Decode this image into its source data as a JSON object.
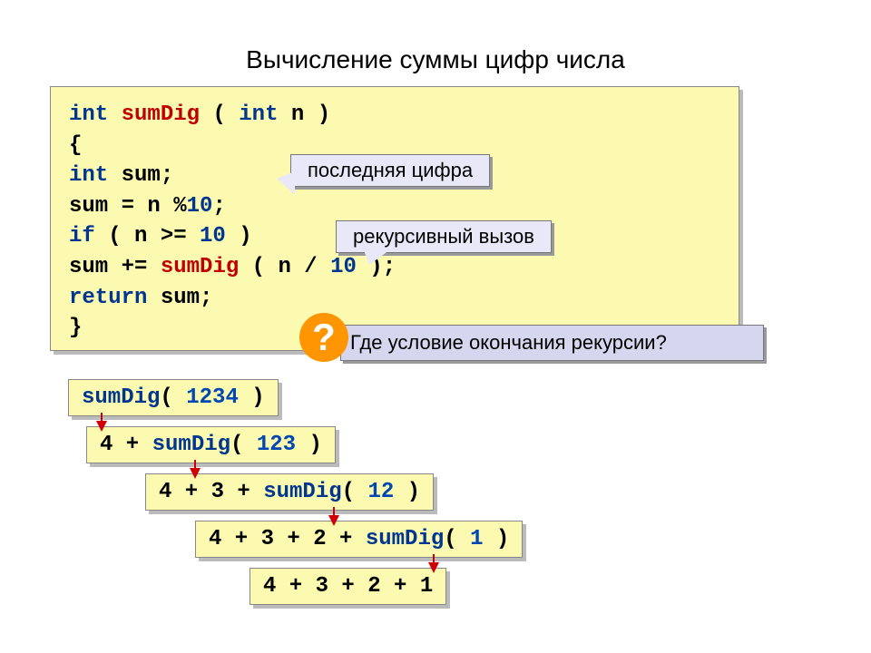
{
  "title": "Вычисление суммы цифр числа",
  "code": {
    "l1_int": "int",
    "l1_fn": "sumDig",
    "l1_rest1": " ( ",
    "l1_int2": "int",
    "l1_rest2": " n )",
    "l2": "{",
    "l3_indent": "   ",
    "l3_int": "int",
    "l3_rest": " sum;",
    "l4_indent": "   ",
    "l4_a": "sum = n %",
    "l4_num": "10",
    "l4_b": ";",
    "l5_indent": "   ",
    "l5_if": "if",
    "l5_a": " ( n >= ",
    "l5_num": "10",
    "l5_b": " )",
    "l6_indent": "    ",
    "l6_a": "sum += ",
    "l6_fn": "sumDig",
    "l6_b": " ( n / ",
    "l6_num": "10",
    "l6_c": " );",
    "l7_indent": "   ",
    "l7_ret": "return",
    "l7_rest": " sum;",
    "l8": "}"
  },
  "callout1": "последняя цифра",
  "callout2": "рекурсивный вызов",
  "question": "Где условие окончания рекурсии?",
  "qmark": "?",
  "trace": {
    "t0_fn": "sumDig",
    "t0_a": "( ",
    "t0_num": "1234",
    "t0_b": " )",
    "t1_a": "4 + ",
    "t1_fn": "sumDig",
    "t1_b": "( ",
    "t1_num": "123",
    "t1_c": " )",
    "t2_a": "4 + 3 + ",
    "t2_fn": "sumDig",
    "t2_b": "( ",
    "t2_num": "12",
    "t2_c": " )",
    "t3_a": "4 + 3 + 2 + ",
    "t3_fn": "sumDig",
    "t3_b": "( ",
    "t3_num": "1",
    "t3_c": " )",
    "t4": "4 + 3 + 2 + 1"
  }
}
